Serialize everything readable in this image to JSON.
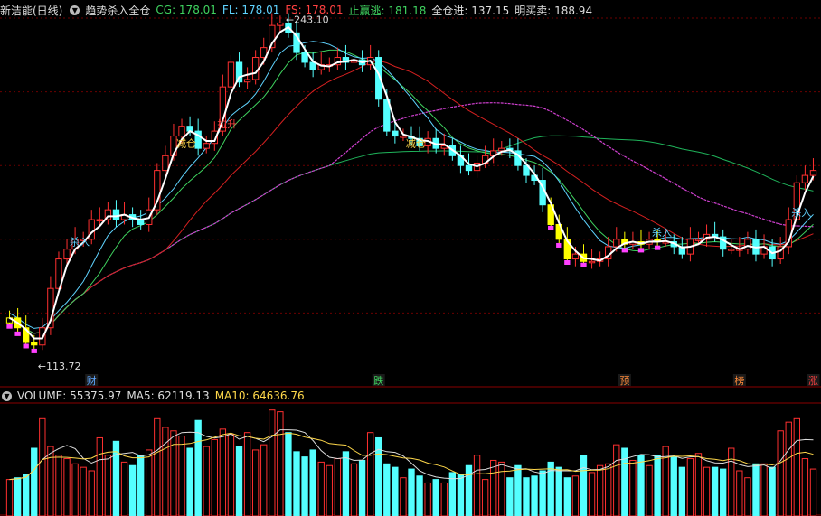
{
  "header": {
    "stock": "新洁能(日线)",
    "indicator": "趋势杀入全仓",
    "cg": "CG: 178.01",
    "fl": "FL: 178.01",
    "fs": "FS: 178.01",
    "zyt": "止赢逃: 181.18",
    "qcj": "全仓进: 137.15",
    "mmm": "明买卖: 188.94"
  },
  "volume_header": {
    "volume": "VOLUME: 55375.97",
    "ma5": "MA5: 62119.13",
    "ma10": "MA10: 64636.76"
  },
  "price_labels": {
    "high": "243.10",
    "low": "113.72"
  },
  "signals": [
    {
      "text": "杀入",
      "color": "#5fd3ff"
    },
    {
      "text": "减仓",
      "color": "#ffd84a"
    },
    {
      "text": "拉升",
      "color": "#ff4040"
    },
    {
      "text": "减仓",
      "color": "#ffd84a"
    },
    {
      "text": "杀入",
      "color": "#5fd3ff"
    },
    {
      "text": "杀入",
      "color": "#5fd3ff"
    }
  ],
  "markers": [
    {
      "text": "财",
      "color": "#5fa8ff"
    },
    {
      "text": "跌",
      "color": "#3fd35f"
    },
    {
      "text": "预",
      "color": "#ff8a3a"
    },
    {
      "text": "榜",
      "color": "#ff8a3a"
    },
    {
      "text": "涨",
      "color": "#ff4040"
    }
  ],
  "colors": {
    "up": "#ff3030",
    "down": "#54ffff",
    "ma_red": "#d42020",
    "ma_green": "#1fb35a",
    "ma_magenta": "#d040d0",
    "line_white": "#ffffff"
  },
  "chart_data": {
    "type": "candlestick",
    "price_range": [
      100,
      250
    ],
    "price_gridlines": [
      130,
      160,
      190,
      220,
      250
    ],
    "closes": [
      128,
      124,
      118,
      117,
      124,
      140,
      152,
      156,
      160,
      160,
      168,
      168,
      172,
      168,
      170,
      168,
      166,
      172,
      188,
      194,
      202,
      206,
      204,
      197,
      199,
      204,
      222,
      232,
      224,
      225,
      234,
      238,
      247,
      248,
      244,
      236,
      232,
      229,
      231,
      231,
      234,
      232,
      233,
      231,
      234,
      217,
      204,
      202,
      202,
      201,
      198,
      201,
      197,
      198,
      194,
      190,
      188,
      191,
      194,
      196,
      197,
      196,
      190,
      186,
      184,
      174,
      166,
      160,
      152,
      154,
      151,
      151,
      152,
      157,
      160,
      158,
      159,
      158,
      160,
      159,
      159,
      157,
      154,
      160,
      160,
      162,
      161,
      156,
      156,
      156,
      160,
      154,
      157,
      152,
      157,
      168,
      183,
      186,
      188
    ],
    "volume_range": [
      0,
      130000
    ],
    "volumes": [
      42000,
      44000,
      48000,
      78000,
      112000,
      80000,
      70000,
      66000,
      60000,
      56000,
      52000,
      90000,
      70000,
      86000,
      62000,
      58000,
      70000,
      76000,
      112000,
      102000,
      98000,
      92000,
      78000,
      110000,
      80000,
      88000,
      100000,
      94000,
      80000,
      96000,
      76000,
      82000,
      122000,
      120000,
      96000,
      74000,
      68000,
      76000,
      62000,
      58000,
      66000,
      74000,
      60000,
      64000,
      96000,
      90000,
      60000,
      56000,
      44000,
      54000,
      46000,
      38000,
      42000,
      38000,
      50000,
      48000,
      58000,
      70000,
      42000,
      64000,
      62000,
      44000,
      58000,
      44000,
      46000,
      52000,
      62000,
      56000,
      44000,
      46000,
      70000,
      50000,
      58000,
      60000,
      82000,
      78000,
      64000,
      70000,
      58000,
      70000,
      80000,
      68000,
      56000,
      66000,
      72000,
      56000,
      56000,
      54000,
      78000,
      52000,
      44000,
      60000,
      60000,
      56000,
      98000,
      108000,
      112000,
      66000,
      54000
    ]
  }
}
